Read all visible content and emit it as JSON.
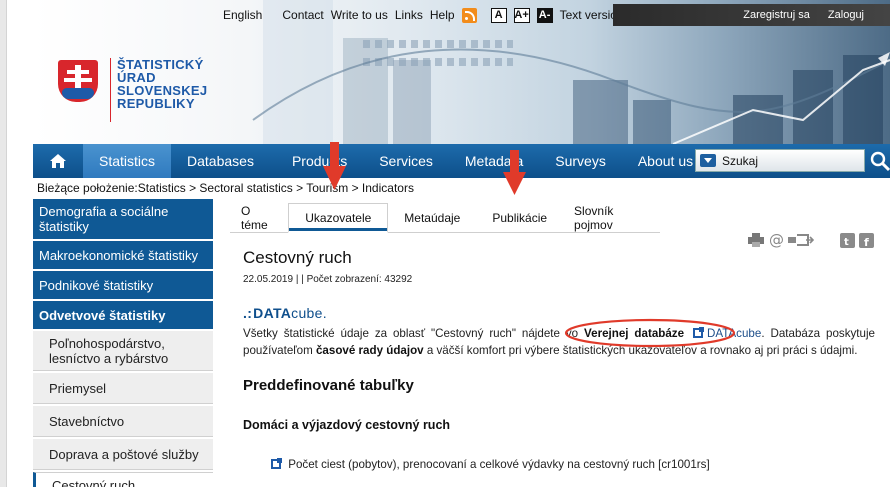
{
  "topbar": {
    "links": [
      "English",
      "Contact",
      "Write to us",
      "Links",
      "Help"
    ],
    "font_buttons": [
      "A",
      "A+",
      "A-"
    ],
    "text_version": "Text version",
    "register": "Zaregistruj sa",
    "login": "Zaloguj"
  },
  "logo": {
    "lines": [
      "ŠTATISTICKÝ",
      "ÚRAD",
      "SLOVENSKEJ",
      "REPUBLIKY"
    ]
  },
  "nav": {
    "items": [
      "Statistics",
      "Databases",
      "Products",
      "Services",
      "Metadata",
      "Surveys",
      "About us"
    ],
    "active": "Statistics",
    "search_label": "Szukaj"
  },
  "breadcrumb": "Bieżące położenie:Statistics > Sectoral statistics > Tourism > Indicators",
  "sidebar": {
    "items": [
      {
        "label": "Demografia a sociálne štatistiky"
      },
      {
        "label": "Makroekonomické štatistiky"
      },
      {
        "label": "Podnikové štatistiky"
      },
      {
        "label": "Odvetvové štatistiky"
      },
      {
        "label": "Poľnohospodárstvo, lesníctvo a rybárstvo"
      },
      {
        "label": "Priemysel"
      },
      {
        "label": "Stavebníctvo"
      },
      {
        "label": "Doprava a poštové služby"
      },
      {
        "label": "Cestovný ruch"
      }
    ]
  },
  "tabs": {
    "items": [
      "O téme",
      "Ukazovatele",
      "Metaúdaje",
      "Publikácie",
      "Slovník pojmov"
    ],
    "active": "Ukazovatele"
  },
  "article": {
    "title": "Cestovný ruch",
    "meta": "22.05.2019 | | Počet zobrazení: 43292",
    "datacube_dots": ".:",
    "datacube_main": "DATA",
    "datacube_suffix": "cube.",
    "para_1": "Všetky štatistické údaje za oblasť \"Cestovný ruch\" nájdete vo ",
    "para_bold_1": "Verejnej databáze",
    "para_link": "DATAcube",
    "para_2": ". Databáza poskytuje používateľom ",
    "para_bold_2": "časové rady údajov",
    "para_3": " a väčší komfort pri výbere štatistických ukazovateľov a rovnako aj pri práci s údajmi.",
    "heading_tables": "Preddefinované tabuľky",
    "heading_domestic": "Domáci a výjazdový cestovný ruch",
    "table_link": "Počet ciest (pobytov), prenocovaní a celkové výdavky na cestovný ruch [cr1001rs]"
  },
  "colors": {
    "nav_blue": "#0d4f8a",
    "accent_red": "#e03a2a",
    "link_blue": "#1e4f8a"
  }
}
